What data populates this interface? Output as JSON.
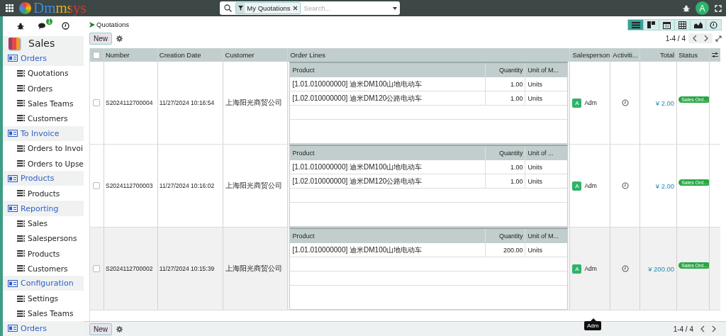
{
  "topbar": {
    "logo": "Dmmsys",
    "search": {
      "facet": "My Quotations",
      "placeholder": "Search..."
    },
    "avatar": "A"
  },
  "sidebar": {
    "chat_badge": "1",
    "app": "Sales",
    "sections": [
      {
        "label": "Orders",
        "items": [
          "Quotations",
          "Orders",
          "Sales Teams",
          "Customers"
        ]
      },
      {
        "label": "To Invoice",
        "items": [
          "Orders to Invoi",
          "Orders to Upse"
        ]
      },
      {
        "label": "Products",
        "items": [
          "Products"
        ]
      },
      {
        "label": "Reporting",
        "items": [
          "Sales",
          "Salespersons",
          "Products",
          "Customers"
        ]
      },
      {
        "label": "Configuration",
        "items": [
          "Settings",
          "Sales Teams"
        ]
      },
      {
        "label": "Orders"
      }
    ]
  },
  "breadcrumb": "Quotations",
  "new_button": "New",
  "views": [
    {
      "kind": "list",
      "selected": true
    },
    {
      "kind": "kanban",
      "selected": false
    },
    {
      "kind": "calendar",
      "selected": false
    },
    {
      "kind": "pivot",
      "selected": false
    },
    {
      "kind": "graph",
      "selected": false
    },
    {
      "kind": "activity",
      "selected": false
    }
  ],
  "pager": "1-4 / 4",
  "table": {
    "all_checked": false,
    "columns": [
      "Number",
      "Creation Date",
      "Customer",
      "Order Lines",
      "Salesperson",
      "Activiti...",
      "Total",
      "Status"
    ],
    "rows": [
      {
        "highlighted": false,
        "number": "S2024112700004",
        "date": "11/27/2024 10:16:54",
        "customer": "上海阳光商贸公司",
        "line_columns": [
          "Product",
          "Quantity",
          "Unit of M..."
        ],
        "lines": [
          {
            "product": "[1.01.010000000] 迪米DM100山地电动车",
            "quantity": "1.00",
            "unit": "Units"
          },
          {
            "product": "[1.02.010000000] 迪米DM120公路电动车",
            "quantity": "1.00",
            "unit": "Units"
          }
        ],
        "salesperson": {
          "initial": "A",
          "name": "Adm"
        },
        "total": "¥ 2.00",
        "status": "Sales Ord..."
      },
      {
        "highlighted": false,
        "number": "S2024112700003",
        "date": "11/27/2024 10:16:02",
        "customer": "上海阳光商贸公司",
        "line_columns": [
          "Product",
          "Quantity",
          "Unit of ..."
        ],
        "lines": [
          {
            "product": "[1.01.010000000] 迪米DM100山地电动车",
            "quantity": "1.00",
            "unit": "Units"
          },
          {
            "product": "[1.02.010000000] 迪米DM120公路电动车",
            "quantity": "1.00",
            "unit": "Units"
          }
        ],
        "salesperson": {
          "initial": "A",
          "name": "Adm"
        },
        "total": "¥ 2.00",
        "status": "Sales Ord..."
      },
      {
        "highlighted": true,
        "number": "S2024112700002",
        "date": "11/27/2024 10:15:39",
        "customer": "上海阳光商贸公司",
        "line_columns": [
          "Product",
          "Quantity",
          "Unit of M..."
        ],
        "lines": [
          {
            "product": "[1.01.010000000] 迪米DM100山地电动车",
            "quantity": "200.00",
            "unit": "Units"
          }
        ],
        "salesperson": {
          "initial": "A",
          "name": "Adm"
        },
        "total": "¥ 200.00",
        "status": "Sales Ord..."
      }
    ]
  },
  "footer": {
    "new_button": "New",
    "pager": "1-4 / 4"
  },
  "tooltip": "Adm"
}
